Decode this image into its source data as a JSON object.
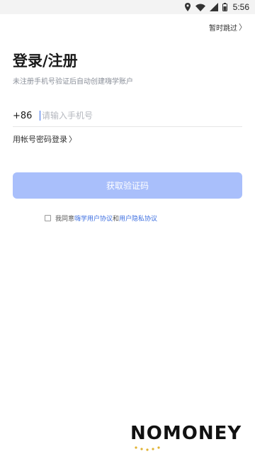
{
  "status_bar": {
    "time": "5:56",
    "icons": [
      "location-icon",
      "wifi-icon",
      "signal-icon",
      "battery-icon"
    ]
  },
  "header": {
    "skip_label": "暂时跳过",
    "skip_chevron": "〉"
  },
  "main": {
    "title": "登录/注册",
    "subtitle": "未注册手机号验证后自动创建嗨学账户",
    "country_code": "+86",
    "phone_placeholder": "请输入手机号",
    "phone_value": "",
    "alt_login_label": "用帐号密码登录",
    "alt_login_chevron": "〉",
    "submit_label": "获取验证码",
    "agreement": {
      "checked": false,
      "prefix": "我同意",
      "link1": "嗨学用户协议",
      "connector": "和",
      "link2": "用户隐私协议"
    }
  },
  "watermark": {
    "text": "NOMONEY"
  },
  "colors": {
    "button_bg": "#a9bffb",
    "link": "#3d6fe0",
    "caret": "#3b6ee6"
  }
}
